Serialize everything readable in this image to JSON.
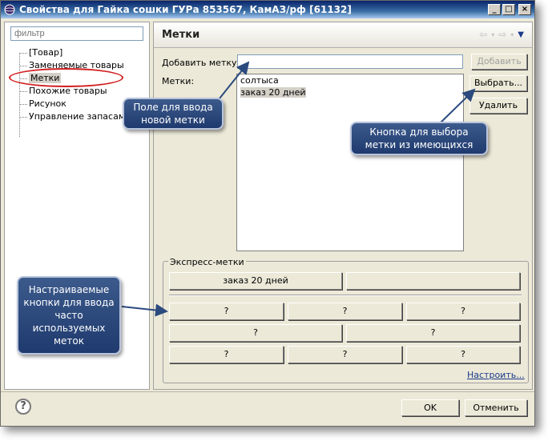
{
  "window": {
    "title": "Свойства для Гайка сошки ГУРа 853567, КамАЗ/рф [61132]",
    "minimize": "_",
    "maximize": "□",
    "close": "×"
  },
  "sidebar": {
    "filter_placeholder": "фильтр",
    "items": [
      {
        "label": "[Товар]"
      },
      {
        "label": "Заменяемые товары"
      },
      {
        "label": "Метки"
      },
      {
        "label": "Похожие товары"
      },
      {
        "label": "Рисунок"
      },
      {
        "label": "Управление запасами"
      }
    ]
  },
  "page": {
    "title": "Метки",
    "add_label": "Добавить метку:",
    "add_value": "",
    "add_button": "Добавить",
    "tags_label": "Метки:",
    "tags": [
      "солтыса",
      "заказ 20 дней"
    ],
    "choose_button": "Выбрать...",
    "delete_button": "Удалить"
  },
  "express": {
    "title": "Экспресс-метки",
    "row1": [
      "заказ 20 дней",
      ""
    ],
    "row2": [
      "?",
      "?",
      "?"
    ],
    "row3": [
      "?",
      "?"
    ],
    "row4": [
      "?",
      "?",
      "?"
    ],
    "configure": "Настроить..."
  },
  "footer": {
    "ok": "OK",
    "cancel": "Отменить"
  },
  "callouts": {
    "input": "Поле для ввода новой метки",
    "choose": "Кнопка для выбора метки из имеющихся",
    "express": "Настраиваемые кнопки для ввода часто используемых меток"
  },
  "colors": {
    "title_bar": "#0a246a",
    "callout": "#2b4a7e",
    "highlight_oval": "#d21f1f",
    "link": "#1b3a8a"
  },
  "icons": [
    "app-icon",
    "help-icon",
    "back-icon",
    "forward-icon",
    "view-menu-icon"
  ]
}
